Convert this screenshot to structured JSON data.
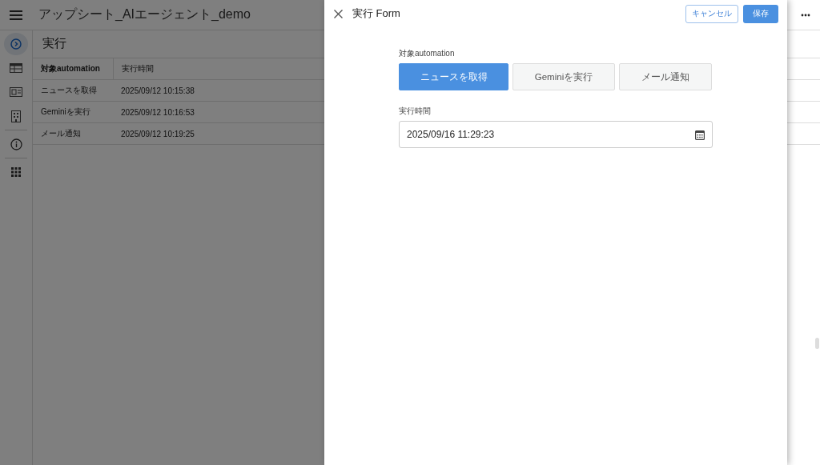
{
  "app": {
    "title": "アップシート_AIエージェント_demo",
    "nav": [
      {
        "kind": "run",
        "selected": true
      },
      {
        "kind": "table",
        "selected": false
      },
      {
        "kind": "card",
        "selected": false
      },
      {
        "kind": "building",
        "selected": false
      },
      {
        "kind": "info",
        "selected": false
      },
      {
        "kind": "apps",
        "selected": false
      }
    ],
    "view": {
      "title": "実行",
      "columns": [
        "対象automation",
        "実行時間"
      ],
      "rows": [
        [
          "ニュースを取得",
          "2025/09/12 10:15:38"
        ],
        [
          "Geminiを実行",
          "2025/09/12 10:16:53"
        ],
        [
          "メール通知",
          "2025/09/12 10:19:25"
        ]
      ]
    }
  },
  "form": {
    "title": "実行 Form",
    "cancel": "キャンセル",
    "save": "保存",
    "fields": [
      {
        "kind": "choice",
        "label": "対象automation",
        "options": [
          {
            "label": "ニュースを取得",
            "selected": true
          },
          {
            "label": "Geminiを実行",
            "selected": false
          },
          {
            "label": "メール通知",
            "selected": false
          }
        ]
      },
      {
        "kind": "datetime",
        "label": "実行時間",
        "value": "2025/09/16 11:29:23"
      }
    ]
  }
}
